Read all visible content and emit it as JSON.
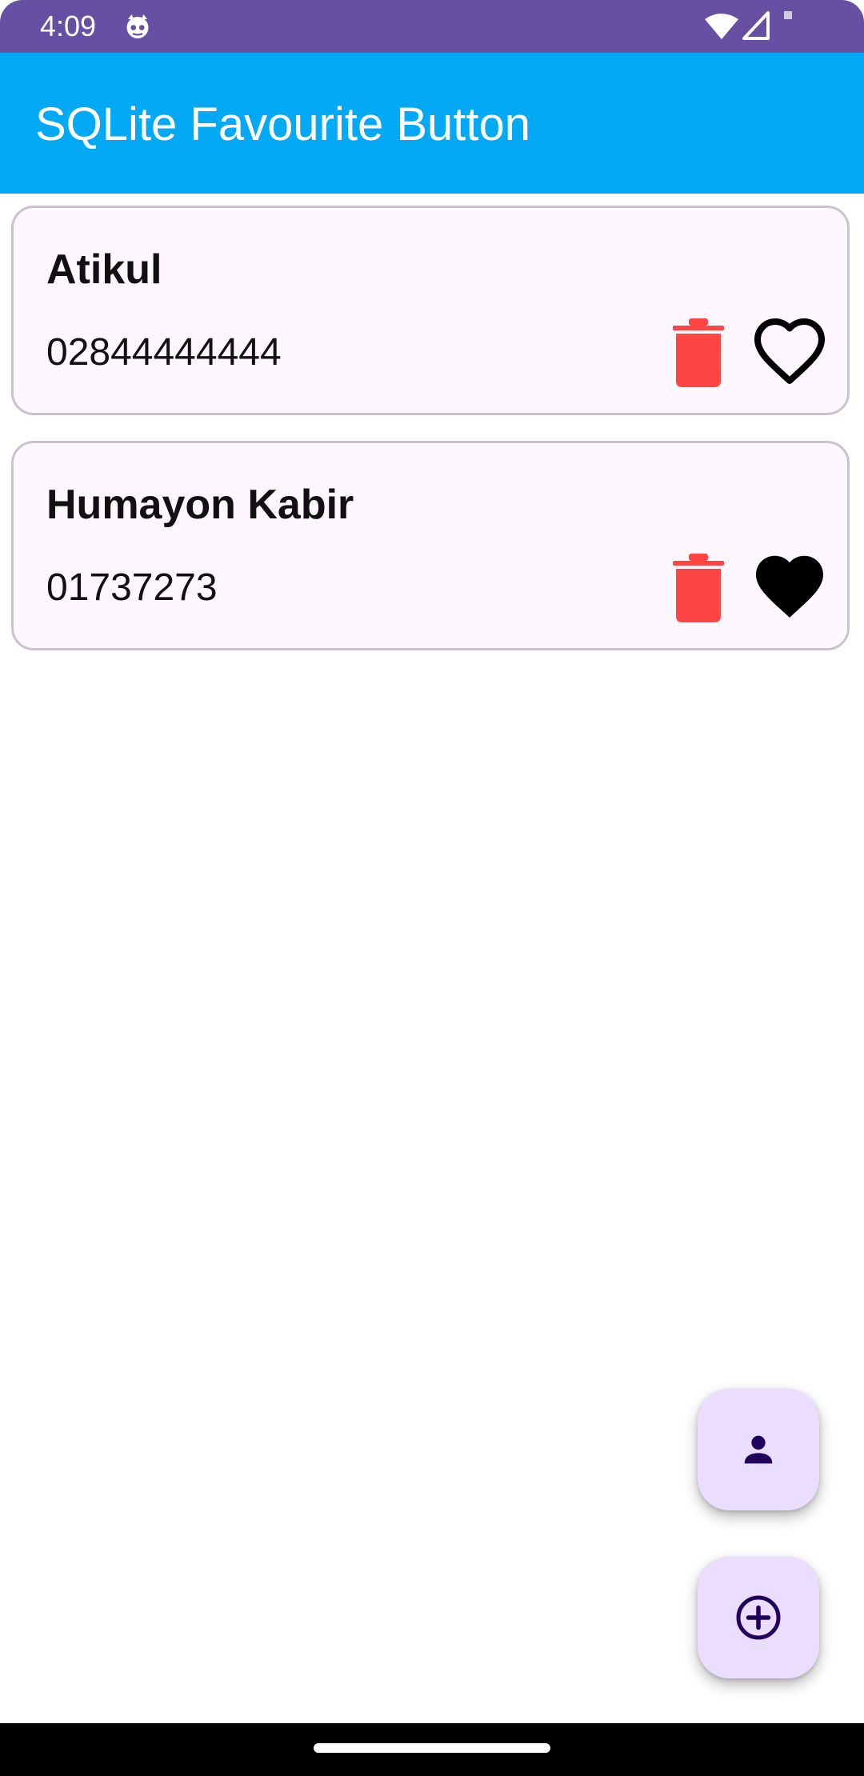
{
  "status_bar": {
    "time": "4:09",
    "icons": [
      "cat-icon",
      "wifi-icon",
      "cell-signal-icon"
    ]
  },
  "app_bar": {
    "title": "SQLite Favourite Button",
    "color": "#03A9F4"
  },
  "contacts": [
    {
      "name": "Atikul",
      "phone": "02844444444",
      "favourite": false,
      "delete_icon": "trash-icon",
      "fav_icon": "heart-outline-icon"
    },
    {
      "name": "Humayon Kabir",
      "phone": "01737273",
      "favourite": true,
      "delete_icon": "trash-icon",
      "fav_icon": "heart-filled-icon"
    }
  ],
  "fabs": [
    {
      "icon": "person-icon"
    },
    {
      "icon": "add-circle-icon"
    }
  ],
  "colors": {
    "status_bar": "#6750A4",
    "card_background": "#FEF7FF",
    "delete": "#FF4444",
    "fab_background": "#EADDFF",
    "fab_icon": "#21005D"
  }
}
